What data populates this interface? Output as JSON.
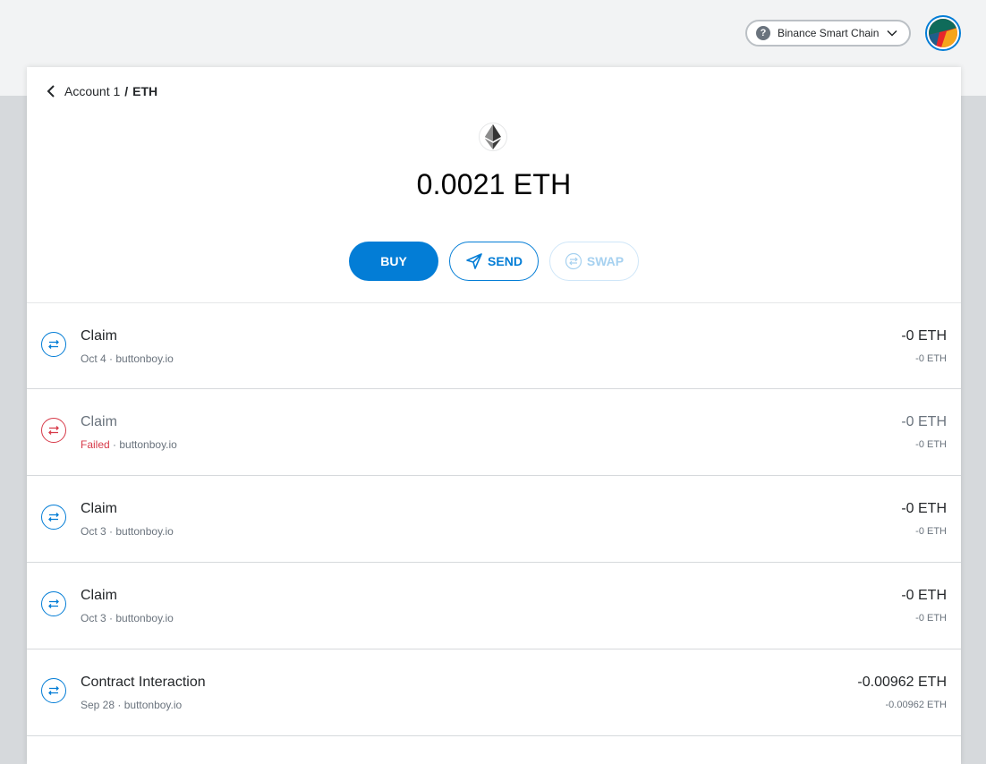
{
  "network": {
    "label": "Binance Smart Chain"
  },
  "breadcrumb": {
    "account": "Account 1",
    "separator": "/",
    "token": "ETH"
  },
  "asset": {
    "balance": "0.0021",
    "symbol": "ETH"
  },
  "actions": {
    "buy": "BUY",
    "send": "SEND",
    "swap": "SWAP"
  },
  "colors": {
    "accent": "#037dd6",
    "failed": "#d73a49"
  },
  "transactions": [
    {
      "title": "Claim",
      "date": "Oct 4",
      "status": "",
      "origin": "buttonboy.io",
      "amount": "-0 ETH",
      "secondary": "-0 ETH",
      "icon": "swap-arrows-icon"
    },
    {
      "title": "Claim",
      "date": "",
      "status": "Failed",
      "origin": "buttonboy.io",
      "amount": "-0 ETH",
      "secondary": "-0 ETH",
      "icon": "swap-arrows-icon"
    },
    {
      "title": "Claim",
      "date": "Oct 3",
      "status": "",
      "origin": "buttonboy.io",
      "amount": "-0 ETH",
      "secondary": "-0 ETH",
      "icon": "swap-arrows-icon"
    },
    {
      "title": "Claim",
      "date": "Oct 3",
      "status": "",
      "origin": "buttonboy.io",
      "amount": "-0 ETH",
      "secondary": "-0 ETH",
      "icon": "swap-arrows-icon"
    },
    {
      "title": "Contract Interaction",
      "date": "Sep 28",
      "status": "",
      "origin": "buttonboy.io",
      "amount": "-0.00962 ETH",
      "secondary": "-0.00962 ETH",
      "icon": "swap-arrows-icon"
    }
  ]
}
